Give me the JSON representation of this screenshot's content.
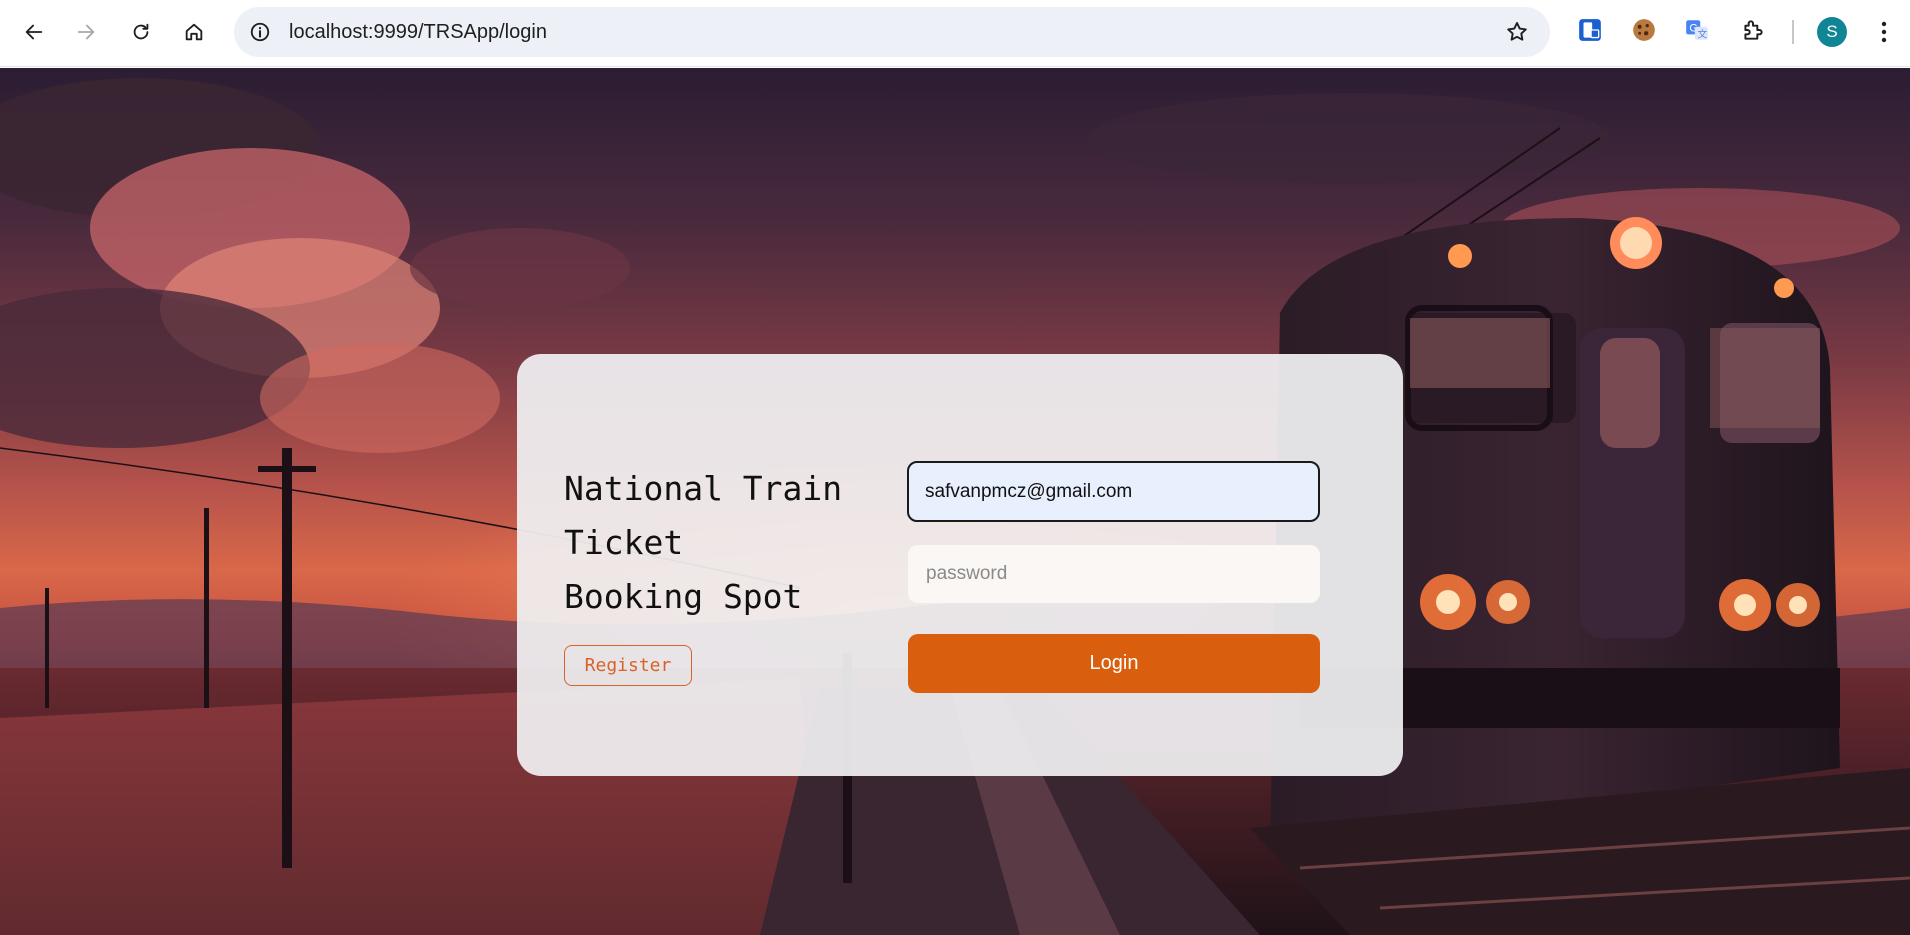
{
  "browser": {
    "url": "localhost:9999/TRSApp/login",
    "avatar_letter": "S"
  },
  "login": {
    "brand_lines": [
      "National Train",
      "Ticket",
      "Booking Spot"
    ],
    "register_label": "Register",
    "email_value": "safvanpmcz@gmail.com",
    "password_placeholder": "password",
    "login_label": "Login"
  },
  "colors": {
    "accent": "#d95f0e",
    "register_border": "#d9622b",
    "autofill_bg": "#e8f0fe",
    "avatar_bg": "#0f8596"
  }
}
